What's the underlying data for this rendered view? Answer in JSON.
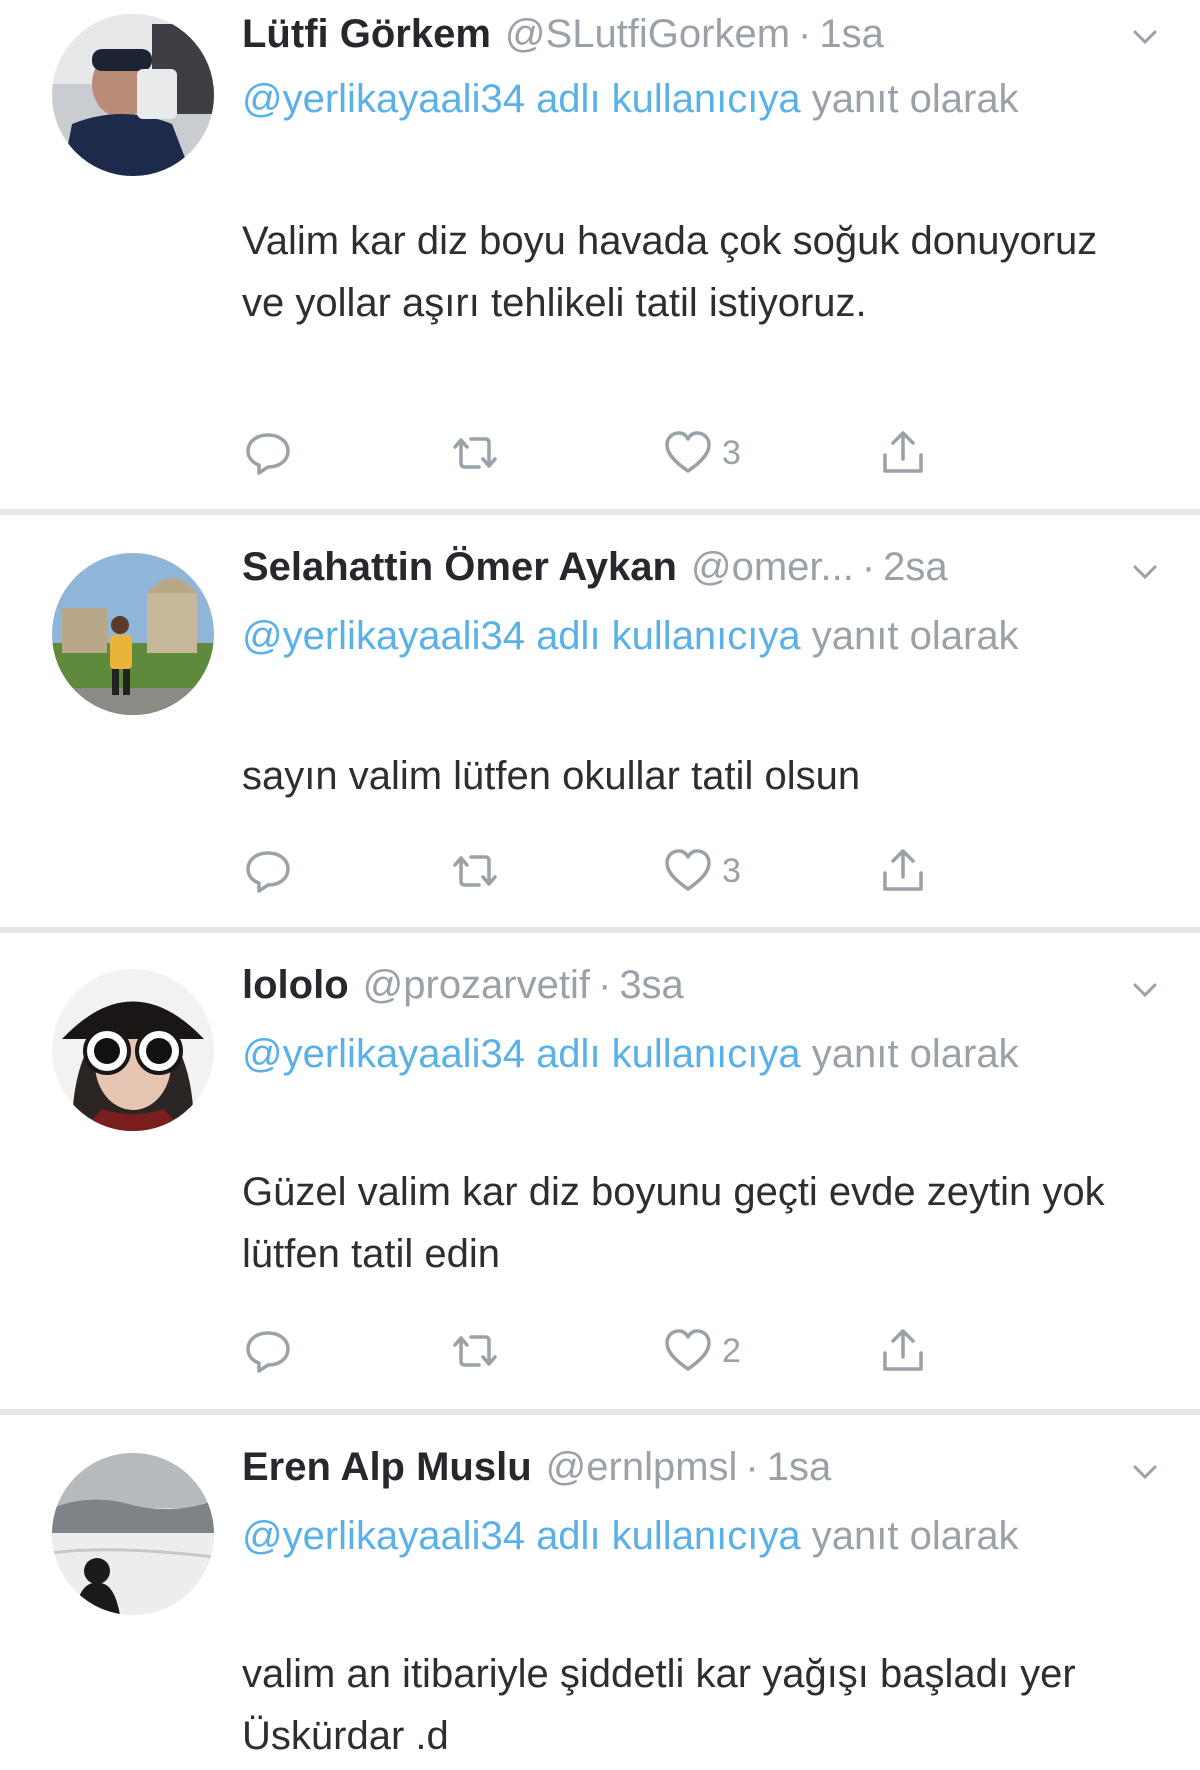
{
  "colors": {
    "accent": "#5ab0e8",
    "muted": "#9aa1a8",
    "text": "#2b2f33",
    "separator": "#e3e7ea",
    "background": "#ffffff"
  },
  "tweets": [
    {
      "name": "Lütfi Görkem",
      "handle": "@SLutfiGorkem",
      "separator": "·",
      "time": "1sa",
      "mention": "@yerlikayaali34 adlı kullanıcıya",
      "reply_suffix": "yanıt olarak",
      "text": "Valim kar diz boyu havada çok soğuk donuyoruz ve yollar aşırı tehlikeli tatil istiyoruz.",
      "likes": "3",
      "icons": [
        "reply-icon",
        "retweet-icon",
        "heart-icon",
        "share-icon",
        "chevron-down-icon"
      ]
    },
    {
      "name": "Selahattin Ömer Aykan",
      "handle": "@omer...",
      "separator": "·",
      "time": "2sa",
      "mention": "@yerlikayaali34 adlı kullanıcıya",
      "reply_suffix": "yanıt olarak",
      "text": "sayın valim lütfen okullar tatil olsun",
      "likes": "3",
      "icons": [
        "reply-icon",
        "retweet-icon",
        "heart-icon",
        "share-icon",
        "chevron-down-icon"
      ]
    },
    {
      "name": "lololo",
      "handle": "@prozarvetif",
      "separator": "·",
      "time": "3sa",
      "mention": "@yerlikayaali34 adlı kullanıcıya",
      "reply_suffix": "yanıt olarak",
      "text": "Güzel valim kar diz boyunu geçti evde zeytin yok lütfen tatil edin",
      "likes": "2",
      "icons": [
        "reply-icon",
        "retweet-icon",
        "heart-icon",
        "share-icon",
        "chevron-down-icon"
      ]
    },
    {
      "name": "Eren Alp Muslu",
      "handle": "@ernlpmsl",
      "separator": "·",
      "time": "1sa",
      "mention": "@yerlikayaali34 adlı kullanıcıya",
      "reply_suffix": "yanıt olarak",
      "text": "valim an itibariyle şiddetli kar yağışı başladı yer Üskürdar .d",
      "icons": [
        "chevron-down-icon"
      ]
    }
  ]
}
